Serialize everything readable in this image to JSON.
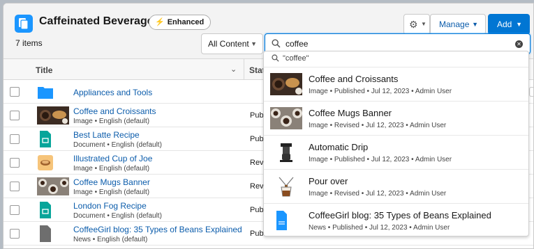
{
  "header": {
    "title": "Caffeinated Beverages",
    "badge": "Enhanced",
    "items_count": "7 items",
    "manage_label": "Manage",
    "add_label": "Add"
  },
  "filter": {
    "selected": "All Content"
  },
  "search": {
    "value": "coffee"
  },
  "table": {
    "columns": {
      "title": "Title",
      "status": "Stat"
    },
    "rows": [
      {
        "name": "Appliances and Tools",
        "meta": "",
        "status": "",
        "icon": "folder-icon"
      },
      {
        "name": "Coffee and Croissants",
        "meta": "Image • English (default)",
        "status": "Publ",
        "icon": "image-thumbnail"
      },
      {
        "name": "Best Latte Recipe",
        "meta": "Document • English (default)",
        "status": "Publ",
        "icon": "document-icon"
      },
      {
        "name": "Illustrated Cup of Joe",
        "meta": "Image • English (default)",
        "status": "Revi",
        "icon": "image-thumbnail"
      },
      {
        "name": "Coffee Mugs Banner",
        "meta": "Image • English (default)",
        "status": "Revi",
        "icon": "image-thumbnail"
      },
      {
        "name": "London Fog Recipe",
        "meta": "Document • English (default)",
        "status": "Publ",
        "icon": "document-icon"
      },
      {
        "name": "CoffeeGirl blog: 35 Types of Beans Explained",
        "meta": "News • English (default)",
        "status": "Publi",
        "icon": "news-icon"
      }
    ]
  },
  "dropdown": {
    "query": "\"coffee\"",
    "items": [
      {
        "name": "Coffee and Croissants",
        "meta": "Image • Published • Jul 12, 2023 • Admin User"
      },
      {
        "name": "Coffee Mugs Banner",
        "meta": "Image • Revised • Jul 12, 2023 • Admin User"
      },
      {
        "name": "Automatic Drip",
        "meta": "Image • Published • Jul 12, 2023 • Admin User"
      },
      {
        "name": "Pour over",
        "meta": "Image • Revised • Jul 12, 2023 • Admin User"
      },
      {
        "name": "CoffeeGirl blog: 35 Types of Beans Explained",
        "meta": "News • Published • Jul 12, 2023 • Admin User"
      }
    ]
  },
  "colors": {
    "brand_blue": "#0176d3",
    "link_blue": "#0b5cab",
    "folder_blue": "#1b96ff",
    "doc_green": "#06a59a"
  }
}
